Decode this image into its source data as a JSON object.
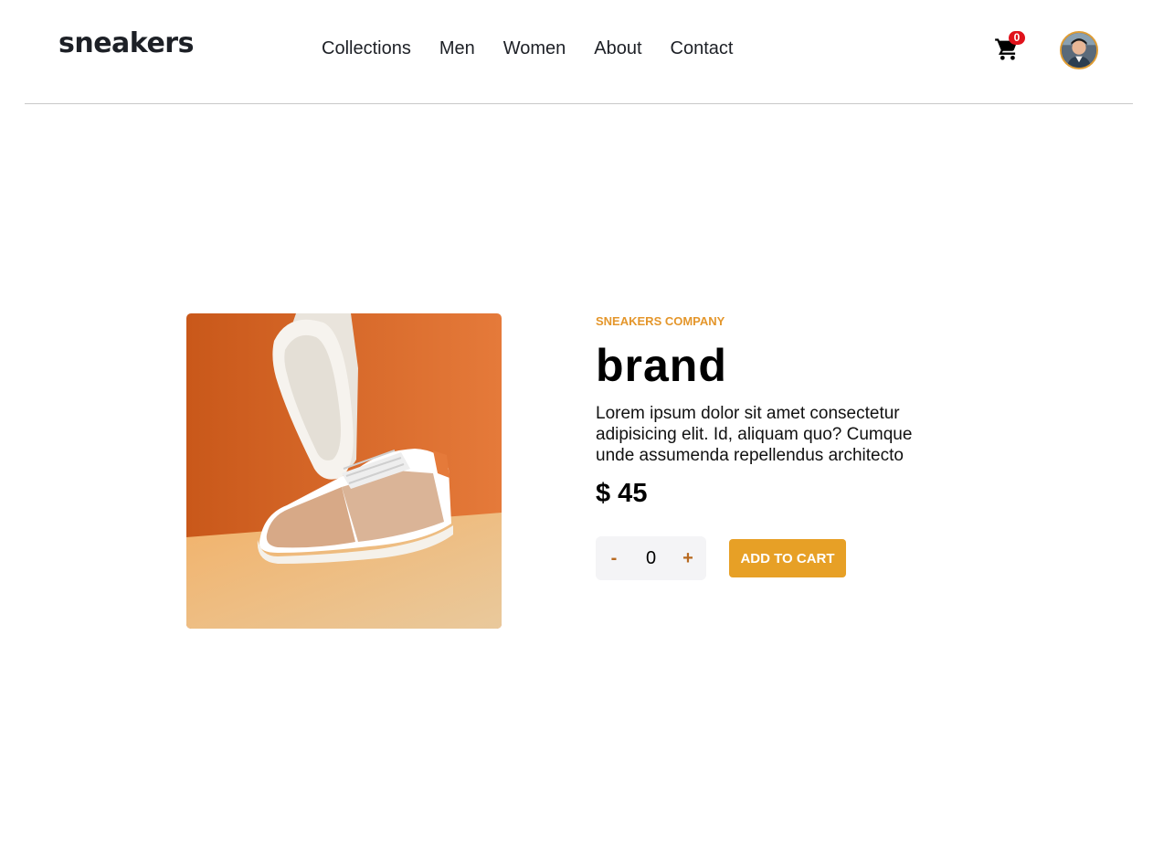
{
  "header": {
    "logo": "sneakers",
    "nav": [
      "Collections",
      "Men",
      "Women",
      "About",
      "Contact"
    ],
    "cart_count": "0"
  },
  "product": {
    "company": "SNEAKERS COMPANY",
    "title": "brand",
    "description": "Lorem ipsum dolor sit amet consectetur adipisicing elit. Id, aliquam quo? Cumque unde assumenda repellendus architecto",
    "price": "$ 45",
    "quantity": "0",
    "minus_label": "-",
    "plus_label": "+",
    "add_to_cart_label": "ADD TO CART"
  },
  "colors": {
    "accent": "#e7a026",
    "badge": "#e0121b"
  }
}
